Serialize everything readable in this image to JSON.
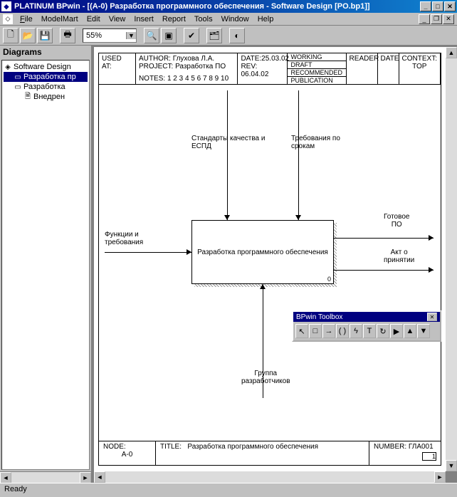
{
  "window": {
    "title": "PLATINUM BPwin - [(A-0) Разработка программного обеспечения - Software Design  [PO.bp1]]"
  },
  "menu": {
    "file": "File",
    "modelmart": "ModelMart",
    "edit": "Edit",
    "view": "View",
    "insert": "Insert",
    "report": "Report",
    "tools": "Tools",
    "window": "Window",
    "help": "Help"
  },
  "toolbar": {
    "zoom": "55%"
  },
  "sidebar": {
    "title": "Diagrams",
    "items": [
      {
        "label": "Software Design"
      },
      {
        "label": "Разработка пр"
      },
      {
        "label": "Разработка"
      },
      {
        "label": "Внедрен"
      }
    ]
  },
  "header": {
    "used_at_label": "USED AT:",
    "author_label": "AUTHOR:",
    "author": "Глухова Л.А.",
    "project_label": "PROJECT:",
    "project": "Разработка ПО",
    "date_label": "DATE:",
    "date": "25.03.02",
    "rev_label": "REV:",
    "rev": "06.04.02",
    "status": {
      "working": "WORKING",
      "draft": "DRAFT",
      "recommended": "RECOMMENDED",
      "publication": "PUBLICATION"
    },
    "reader": "READER",
    "date2": "DATE",
    "context_label": "CONTEXT:",
    "context": "TOP",
    "notes_label": "NOTES:",
    "notes": "1 2 3 4 5 6 7 8 9 10"
  },
  "diagram": {
    "activity": "Разработка программного обеспечения",
    "activity_num": "0",
    "input": "Функции и\nтребования",
    "control1": "Стандарты качества и\nЕСПД",
    "control2": "Требования по\nсрокам",
    "output1": "Готовое\nПО",
    "output2": "Акт о\nпринятии",
    "mechanism": "Группа\nразработчиков"
  },
  "footer": {
    "node_label": "NODE:",
    "node": "A-0",
    "title_label": "TITLE:",
    "title": "Разработка программного обеспечения",
    "number_label": "NUMBER:",
    "number": "ГЛА001",
    "page": "1"
  },
  "toolbox": {
    "title": "BPwin Toolbox"
  },
  "status": "Ready"
}
